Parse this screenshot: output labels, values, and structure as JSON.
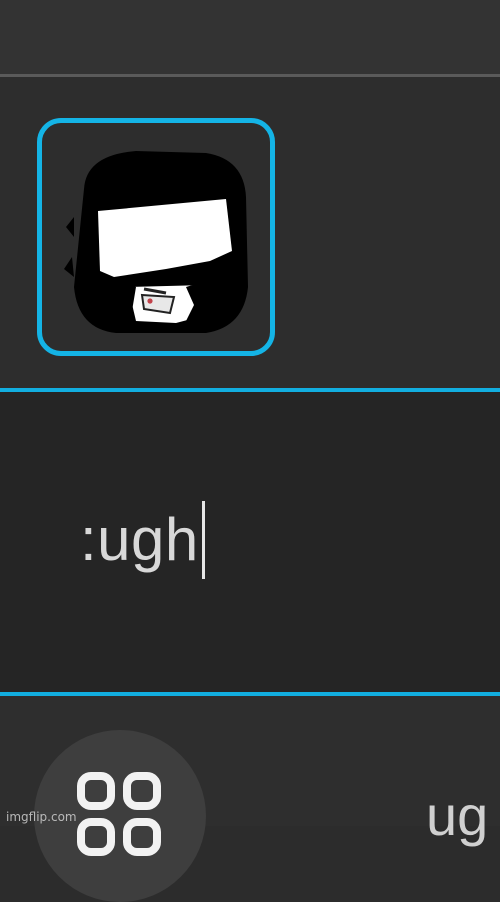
{
  "emoji_picker": {
    "selected_emoji_icon": "bearded-sunglasses-face-emoji"
  },
  "message_input": {
    "value": ":ugh"
  },
  "bottom_bar": {
    "apps_icon": "grid-apps-icon",
    "partial_label": "ug"
  },
  "watermark": {
    "text": "imgflip.com"
  },
  "colors": {
    "accent": "#12aee0",
    "background": "#252525",
    "top_divider": "#5a5a5a"
  }
}
